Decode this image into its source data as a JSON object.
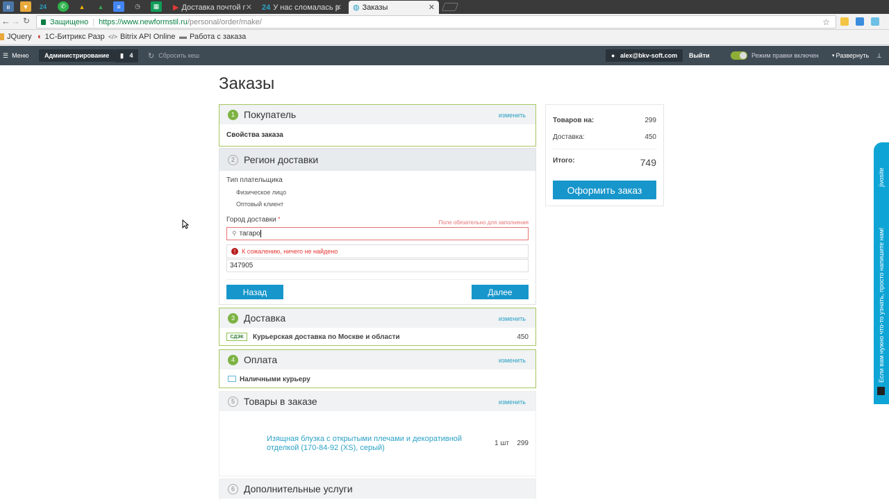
{
  "browser": {
    "tabs": [
      {
        "label": "Доставка почтой г",
        "active": false
      },
      {
        "label": "У нас сломалась р",
        "active": false
      },
      {
        "label": "Заказы",
        "active": true
      }
    ],
    "pinned_tabs": [
      "vk-icon",
      "mail-icon",
      "24",
      "whatsapp-icon",
      "drive-icon",
      "drive-icon",
      "docs-icon",
      "clock-icon",
      "sheets-icon",
      "youtube-icon"
    ],
    "secure_label": "Защищено",
    "url_base": "https://www.newformstil.ru",
    "url_path": "/personal/order/make/",
    "bookmarks": [
      "JQuery",
      "1С-Битрикс Разр",
      "Bitrix API Online",
      "Работа с заказа"
    ]
  },
  "admin_panel": {
    "menu": "Меню",
    "admin": "Администрирование",
    "notif_count": "4",
    "reset_cache": "Сбросить кеш",
    "user": "alex@bkv-soft.com",
    "logout": "Выйти",
    "edit_mode": "Режим правки включен",
    "expand": "Развернуть"
  },
  "page": {
    "title": "Заказы"
  },
  "sections": {
    "buyer": {
      "num": "1",
      "title": "Покупатель",
      "change": "изменить",
      "body": "Свойства заказа"
    },
    "region": {
      "num": "2",
      "title": "Регион доставки",
      "payer_type_label": "Тип плательщика",
      "payer_options": [
        "Физическое лицо",
        "Оптовый клиент"
      ],
      "city_label": "Город доставки",
      "required_mark": "*",
      "required_note": "Поле обязательно для заполнения",
      "city_value": "тагаро",
      "not_found": "К сожалению, ничего не найдено",
      "zip": "347905",
      "back": "Назад",
      "next": "Далее"
    },
    "delivery": {
      "num": "3",
      "title": "Доставка",
      "change": "изменить",
      "logo": "СДЭК",
      "item": "Курьерская доставка по Москве и области",
      "price": "450"
    },
    "payment": {
      "num": "4",
      "title": "Оплата",
      "change": "изменить",
      "item": "Наличными курьеру"
    },
    "goods": {
      "num": "5",
      "title": "Товары в заказе",
      "change": "изменить",
      "product": "Изящная блузка с открытыми плечами и декоративной отделкой (170-84-92 (XS), серый)",
      "qty": "1 шт",
      "price": "299"
    },
    "extra": {
      "num": "6",
      "title": "Дополнительные услуги"
    }
  },
  "summary": {
    "goods_label": "Товаров на:",
    "goods_value": "299",
    "delivery_label": "Доставка:",
    "delivery_value": "450",
    "total_label": "Итого:",
    "total_value": "749",
    "order_button": "Оформить заказ"
  },
  "jivosite": {
    "text": "Если вам нужно что-то узнать, просто напишите нам!",
    "brand": "jivosite"
  }
}
